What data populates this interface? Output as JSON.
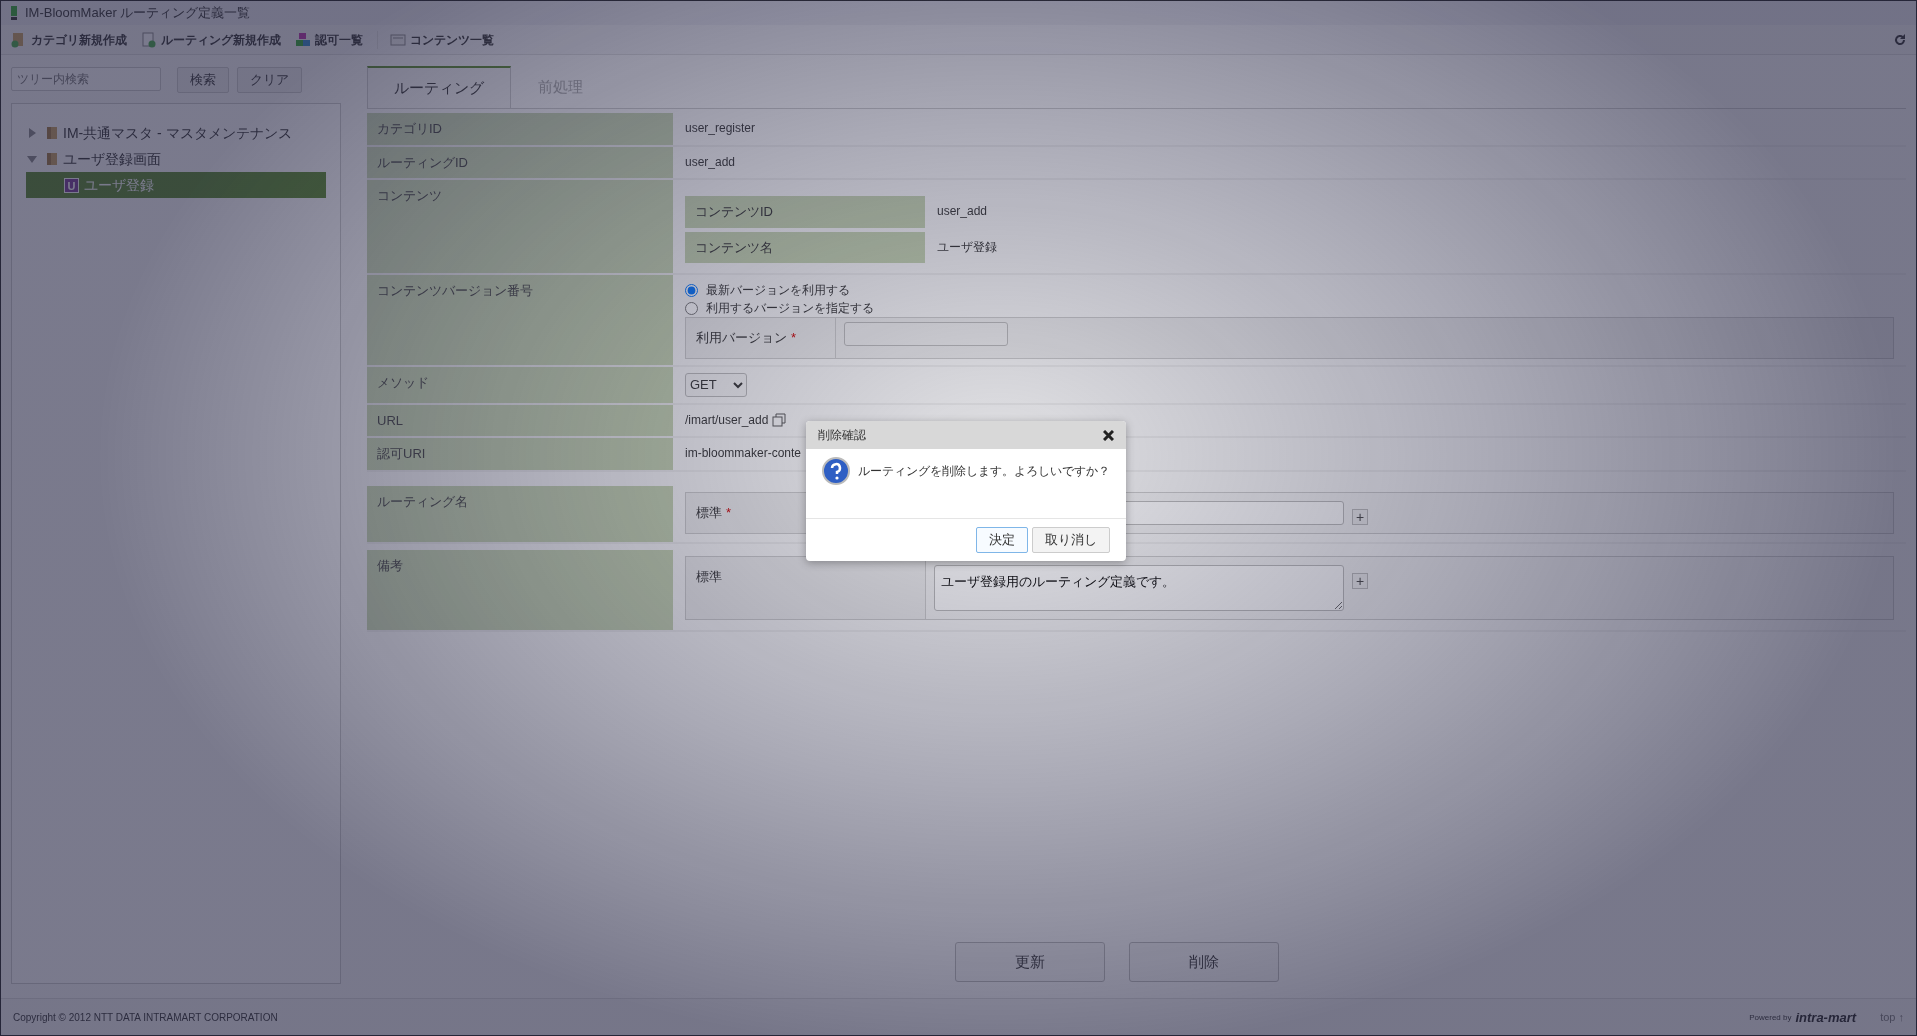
{
  "window": {
    "title": "IM-BloomMaker ルーティング定義一覧"
  },
  "toolbar": [
    {
      "label": "カテゴリ新規作成",
      "kind": "category"
    },
    {
      "label": "ルーティング新規作成",
      "kind": "routing"
    },
    {
      "label": "認可一覧",
      "kind": "auth"
    },
    {
      "label": "コンテンツ一覧",
      "kind": "content"
    }
  ],
  "tree_search": {
    "placeholder": "ツリー内検索",
    "buttons": [
      "検索",
      "クリア"
    ]
  },
  "tree": [
    {
      "label": "IM-共通マスタ - マスタメンテナンス",
      "expanded": false,
      "selected": false
    },
    {
      "label": "ユーザ登録画面",
      "expanded": true,
      "selected": false,
      "children": [
        {
          "label": "ユーザ登録",
          "badge": "U",
          "selected": true
        }
      ]
    }
  ],
  "tabs": [
    {
      "label": "ルーティング",
      "selected": true
    },
    {
      "label": "前処理",
      "selected": false
    }
  ],
  "form": [
    {
      "kind": "text",
      "label": "カテゴリID",
      "value": "user_register"
    },
    {
      "kind": "text",
      "label": "ルーティングID",
      "value": "user_add"
    },
    {
      "kind": "content",
      "label": "コンテンツ",
      "fields": [
        {
          "label": "コンテンツID",
          "value": "user_add"
        },
        {
          "label": "コンテンツ名",
          "value": "ユーザ登録"
        }
      ]
    },
    {
      "kind": "version",
      "label": "コンテンツバージョン番号",
      "options": [
        {
          "label": "最新バージョンを利用する",
          "selected": true
        },
        {
          "label": "利用するバージョンを指定する",
          "selected": false
        }
      ],
      "field_label": "利用バージョン",
      "required_mark": "*"
    },
    {
      "kind": "select",
      "label": "メソッド",
      "value": "GET"
    },
    {
      "kind": "url",
      "label": "URL",
      "value": "/imart/user_add"
    },
    {
      "kind": "text",
      "label": "認可URI",
      "value": "im-bloommaker-conte"
    },
    {
      "kind": "i18n_input",
      "label": "ルーティング名",
      "locale": "標準",
      "required_mark": "*",
      "add_button": "+"
    },
    {
      "kind": "i18n_textarea",
      "label": "備考",
      "locale": "標準",
      "add_button": "+",
      "value": "ユーザ登録用のルーティング定義です。"
    }
  ],
  "actions": [
    "更新",
    "削除"
  ],
  "footer": {
    "copyright": "Copyright © 2012 NTT DATA INTRAMART CORPORATION",
    "powered": "Powered by",
    "brand": "intra-mart",
    "top_link": "top ↑"
  },
  "dialog": {
    "title": "削除確認",
    "message": "ルーティングを削除します。よろしいですか？",
    "buttons": [
      {
        "label": "決定",
        "focused": true
      },
      {
        "label": "取り消し",
        "focused": false
      }
    ]
  }
}
